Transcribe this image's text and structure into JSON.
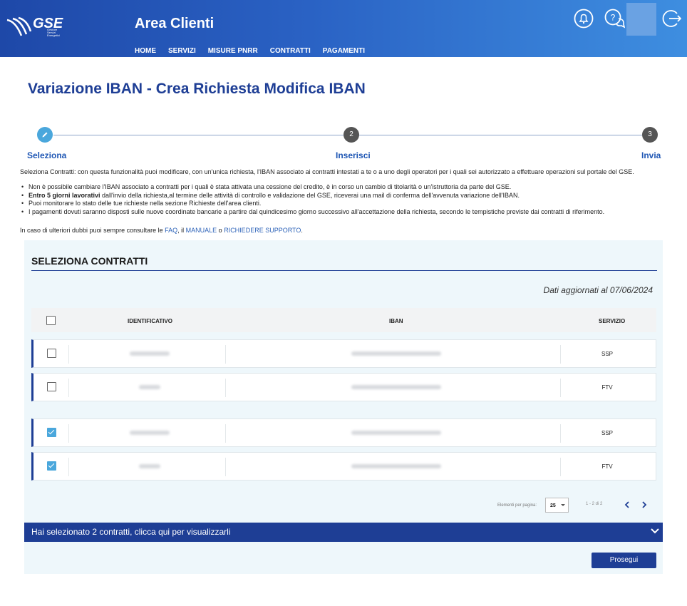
{
  "header": {
    "logo_text": "GSE",
    "logo_subtext": "Gestore Servizi Energetici",
    "title": "Area Clienti",
    "nav": [
      "HOME",
      "SERVIZI",
      "MISURE PNRR",
      "CONTRATTI",
      "PAGAMENTI"
    ],
    "icons": [
      "bell-icon",
      "help-chat-icon",
      "logout-icon"
    ]
  },
  "page": {
    "title": "Variazione IBAN - Crea Richiesta Modifica IBAN"
  },
  "stepper": {
    "steps": [
      {
        "number": "1",
        "label": "Seleziona",
        "state": "active"
      },
      {
        "number": "2",
        "label": "Inserisci",
        "state": "pending"
      },
      {
        "number": "3",
        "label": "Invia",
        "state": "pending"
      }
    ]
  },
  "intro": "Seleziona Contratti: con questa funzionalità puoi modificare, con un'unica richiesta, l'IBAN associato ai contratti intestati a te o a uno degli operatori per i quali sei autorizzato a effettuare operazioni sul portale del GSE.",
  "bullets": {
    "b1": "Non è possibile cambiare l'IBAN associato a contratti per i quali è stata attivata una cessione del credito, è in corso un cambio di titolarità o un'istruttoria da parte del GSE.",
    "b2_bold": "Entro 5 giorni lavorativi",
    "b2_rest": " dall'invio della richiesta,al termine delle attività di controllo e validazione del GSE, riceverai una mail di conferma dell'avvenuta variazione dell'IBAN.",
    "b3": "Puoi monitorare lo stato delle tue richieste nella sezione Richieste dell'area clienti.",
    "b4": "I pagamenti dovuti saranno disposti sulle nuove coordinate bancarie a partire dal quindicesimo giorno successivo all'accettazione della richiesta, secondo le tempistiche previste dai contratti di riferimento."
  },
  "help": {
    "prefix": "In caso di ulteriori dubbi puoi sempre consultare le ",
    "faq": "FAQ",
    "sep1": ", il ",
    "manual": "MANUALE",
    "sep2": " o ",
    "support": "RICHIEDERE SUPPORTO",
    "suffix": "."
  },
  "panel": {
    "title": "SELEZIONA CONTRATTI",
    "updated": "Dati aggiornati al 07/06/2024",
    "columns": [
      "IDENTIFICATIVO",
      "IBAN",
      "SERVIZIO"
    ],
    "available_rows": [
      {
        "checked": false,
        "servizio": "SSP"
      },
      {
        "checked": false,
        "servizio": "FTV"
      }
    ],
    "selected_rows": [
      {
        "checked": true,
        "servizio": "SSP"
      },
      {
        "checked": true,
        "servizio": "FTV"
      }
    ],
    "pagination": {
      "label": "Elementi per pagina:",
      "page_size": "25",
      "range": "1 - 2 di 2"
    },
    "selection_bar": "Hai selezionato 2 contratti, clicca qui per visualizzarli",
    "next_button": "Prosegui"
  },
  "colors": {
    "primary": "#1e3e95",
    "accent": "#4aa7dc",
    "panel_bg": "#eef7fb"
  }
}
